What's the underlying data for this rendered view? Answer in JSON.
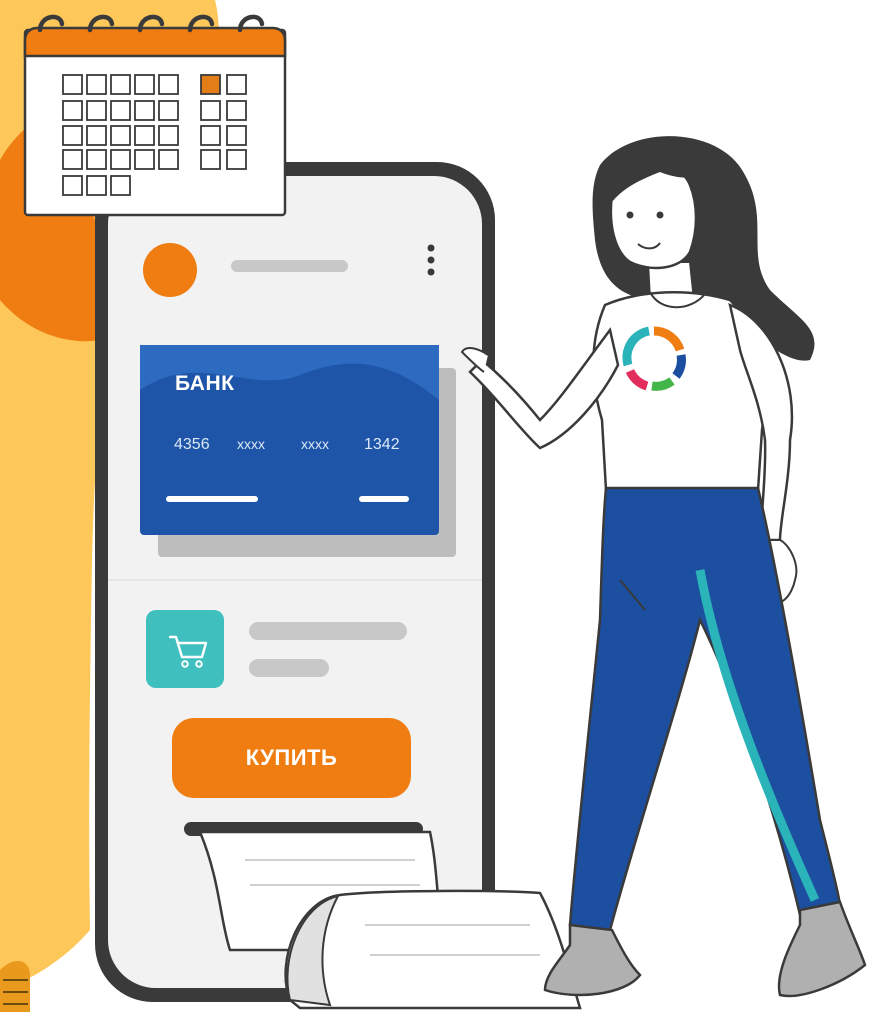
{
  "card": {
    "bank_name": "БАНК",
    "number_groups": [
      "4356",
      "xxxx",
      "xxxx",
      "1342"
    ]
  },
  "buy_button": {
    "label": "КУПИТЬ"
  },
  "icons": {
    "calendar": "calendar-icon",
    "cart": "shopping-cart-icon",
    "menu": "kebab-menu-icon",
    "logo": "ring-logo-icon"
  },
  "colors": {
    "accent_orange": "#ef7d11",
    "card_blue": "#1e55a8",
    "pants_blue": "#1c4fa0",
    "teal": "#2ab3b9",
    "yellow": "#fdc75a",
    "dark_outline": "#3a3a3a"
  }
}
